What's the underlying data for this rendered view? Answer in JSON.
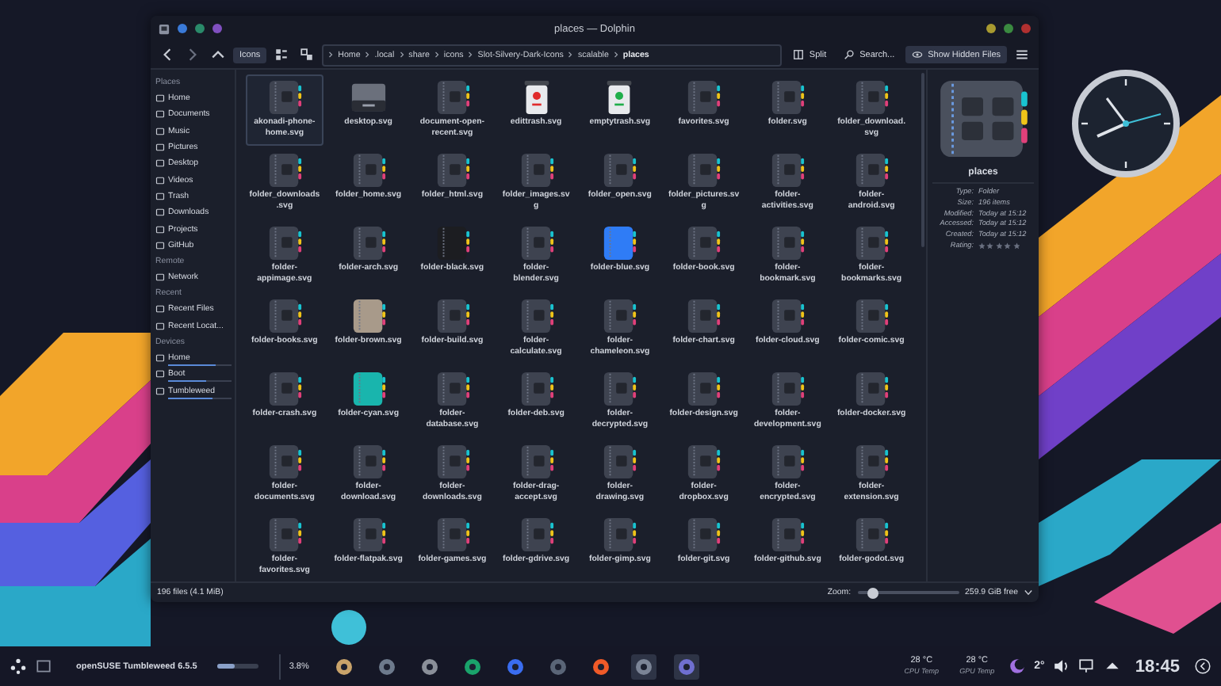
{
  "window": {
    "title": "places — Dolphin"
  },
  "toolbar": {
    "view_mode": {
      "label": "Icons",
      "selected": true
    },
    "breadcrumbs": [
      "Home",
      ".local",
      "share",
      "icons",
      "Slot-Silvery-Dark-Icons",
      "scalable",
      "places"
    ],
    "split": "Split",
    "search": "Search...",
    "hidden_files": "Show Hidden Files"
  },
  "sidebar": {
    "sections": [
      {
        "title": "Places",
        "items": [
          {
            "label": "Home"
          },
          {
            "label": "Documents"
          },
          {
            "label": "Music"
          },
          {
            "label": "Pictures"
          },
          {
            "label": "Desktop"
          },
          {
            "label": "Videos"
          },
          {
            "label": "Trash"
          },
          {
            "label": "Downloads"
          },
          {
            "label": "Projects"
          },
          {
            "label": "GitHub"
          }
        ]
      },
      {
        "title": "Remote",
        "items": [
          {
            "label": "Network"
          }
        ]
      },
      {
        "title": "Recent",
        "items": [
          {
            "label": "Recent Files"
          },
          {
            "label": "Recent Locat..."
          }
        ]
      },
      {
        "title": "Devices",
        "items": [
          {
            "label": "Home",
            "level": 0.75
          },
          {
            "label": "Boot",
            "level": 0.6
          },
          {
            "label": "Tumbleweed",
            "level": 0.7
          }
        ]
      }
    ]
  },
  "files": [
    {
      "name": "akonadi-phone-home.svg",
      "kind": "folder",
      "selected": true
    },
    {
      "name": "desktop.svg",
      "kind": "desktop",
      "selected": false
    },
    {
      "name": "document-open-recent.svg",
      "kind": "folder",
      "selected": false
    },
    {
      "name": "edittrash.svg",
      "kind": "trash",
      "color": "#e02b2b",
      "selected": false
    },
    {
      "name": "emptytrash.svg",
      "kind": "trash",
      "color": "#1fae4a",
      "selected": false
    },
    {
      "name": "favorites.svg",
      "kind": "folder",
      "selected": false
    },
    {
      "name": "folder.svg",
      "kind": "folder",
      "selected": false
    },
    {
      "name": "folder_download.svg",
      "kind": "folder",
      "selected": false
    },
    {
      "name": "folder_downloads.svg",
      "kind": "folder",
      "selected": false
    },
    {
      "name": "folder_home.svg",
      "kind": "folder",
      "selected": false
    },
    {
      "name": "folder_html.svg",
      "kind": "folder",
      "selected": false
    },
    {
      "name": "folder_images.svg",
      "kind": "folder",
      "selected": false
    },
    {
      "name": "folder_open.svg",
      "kind": "folder",
      "selected": false
    },
    {
      "name": "folder_pictures.svg",
      "kind": "folder",
      "selected": false
    },
    {
      "name": "folder-activities.svg",
      "kind": "folder",
      "selected": false
    },
    {
      "name": "folder-android.svg",
      "kind": "folder",
      "selected": false
    },
    {
      "name": "folder-appimage.svg",
      "kind": "folder",
      "selected": false
    },
    {
      "name": "folder-arch.svg",
      "kind": "folder",
      "selected": false
    },
    {
      "name": "folder-black.svg",
      "kind": "colored",
      "color": "#1c1d21",
      "selected": false
    },
    {
      "name": "folder-blender.svg",
      "kind": "folder",
      "selected": false
    },
    {
      "name": "folder-blue.svg",
      "kind": "colored",
      "color": "#2f7cf6",
      "selected": false
    },
    {
      "name": "folder-book.svg",
      "kind": "folder",
      "selected": false
    },
    {
      "name": "folder-bookmark.svg",
      "kind": "folder",
      "selected": false
    },
    {
      "name": "folder-bookmarks.svg",
      "kind": "folder",
      "selected": false
    },
    {
      "name": "folder-books.svg",
      "kind": "folder",
      "selected": false
    },
    {
      "name": "folder-brown.svg",
      "kind": "colored",
      "color": "#a89a8a",
      "selected": false
    },
    {
      "name": "folder-build.svg",
      "kind": "folder",
      "selected": false
    },
    {
      "name": "folder-calculate.svg",
      "kind": "folder",
      "selected": false
    },
    {
      "name": "folder-chameleon.svg",
      "kind": "folder",
      "selected": false
    },
    {
      "name": "folder-chart.svg",
      "kind": "folder",
      "selected": false
    },
    {
      "name": "folder-cloud.svg",
      "kind": "folder",
      "selected": false
    },
    {
      "name": "folder-comic.svg",
      "kind": "folder",
      "selected": false
    },
    {
      "name": "folder-crash.svg",
      "kind": "folder",
      "selected": false
    },
    {
      "name": "folder-cyan.svg",
      "kind": "colored",
      "color": "#19b5ad",
      "selected": false
    },
    {
      "name": "folder-database.svg",
      "kind": "folder",
      "selected": false
    },
    {
      "name": "folder-deb.svg",
      "kind": "folder",
      "selected": false
    },
    {
      "name": "folder-decrypted.svg",
      "kind": "folder",
      "selected": false
    },
    {
      "name": "folder-design.svg",
      "kind": "folder",
      "selected": false
    },
    {
      "name": "folder-development.svg",
      "kind": "folder",
      "selected": false
    },
    {
      "name": "folder-docker.svg",
      "kind": "folder",
      "selected": false
    },
    {
      "name": "folder-documents.svg",
      "kind": "folder",
      "selected": false
    },
    {
      "name": "folder-download.svg",
      "kind": "folder",
      "selected": false
    },
    {
      "name": "folder-downloads.svg",
      "kind": "folder",
      "selected": false
    },
    {
      "name": "folder-drag-accept.svg",
      "kind": "folder",
      "selected": false
    },
    {
      "name": "folder-drawing.svg",
      "kind": "folder",
      "selected": false
    },
    {
      "name": "folder-dropbox.svg",
      "kind": "folder",
      "selected": false
    },
    {
      "name": "folder-encrypted.svg",
      "kind": "folder",
      "selected": false
    },
    {
      "name": "folder-extension.svg",
      "kind": "folder",
      "selected": false
    },
    {
      "name": "folder-favorites.svg",
      "kind": "folder",
      "selected": false
    },
    {
      "name": "folder-flatpak.svg",
      "kind": "folder",
      "selected": false
    },
    {
      "name": "folder-games.svg",
      "kind": "folder",
      "selected": false
    },
    {
      "name": "folder-gdrive.svg",
      "kind": "folder",
      "selected": false
    },
    {
      "name": "folder-gimp.svg",
      "kind": "folder",
      "selected": false
    },
    {
      "name": "folder-git.svg",
      "kind": "folder",
      "selected": false
    },
    {
      "name": "folder-github.svg",
      "kind": "folder",
      "selected": false
    },
    {
      "name": "folder-godot.svg",
      "kind": "folder",
      "selected": false
    }
  ],
  "info_panel": {
    "name": "places",
    "properties": [
      {
        "label": "Type:",
        "value": "Folder"
      },
      {
        "label": "Size:",
        "value": "196 items"
      },
      {
        "label": "Modified:",
        "value": "Today at 15:12"
      },
      {
        "label": "Accessed:",
        "value": "Today at 15:12"
      },
      {
        "label": "Created:",
        "value": "Today at 15:12"
      }
    ],
    "rating": {
      "label": "Rating:",
      "stars": 0
    }
  },
  "status_bar": {
    "summary": "196 files (4.1 MiB)",
    "zoom_label": "Zoom:",
    "zoom": {
      "level": 0.15
    },
    "free_space": "259.9 GiB free"
  },
  "taskbar": {
    "window_title": "openSUSE Tumbleweed 6.5.5",
    "usage": {
      "level": 0.4
    },
    "cpu_load": "3.8%",
    "sensors": [
      {
        "value": "28 °C",
        "label": "CPU Temp"
      },
      {
        "value": "28 °C",
        "label": "GPU Temp"
      }
    ],
    "weather": "2°",
    "time": "18:45"
  }
}
